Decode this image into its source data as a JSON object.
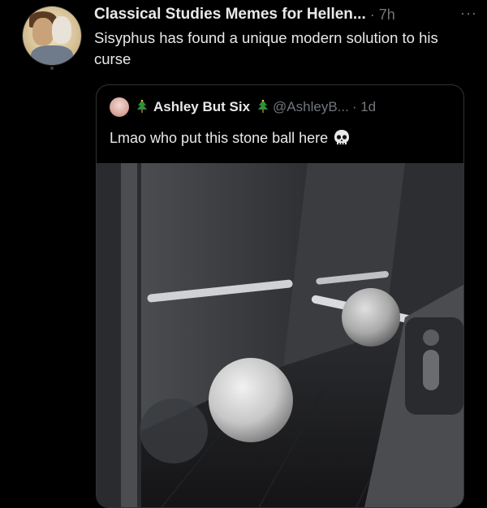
{
  "tweet": {
    "author_name": "Classical Studies Memes for Hellen...",
    "time": "· 7h",
    "more": "···",
    "text": "Sisyphus has found a unique modern solution to his curse"
  },
  "quoted_tweet": {
    "author_name": "Ashley But Six",
    "handle": "@AshleyB...",
    "time": "· 1d",
    "text": "Lmao who put this stone ball here"
  },
  "icons": {
    "avatar": "profile-avatar",
    "tree": "christmas-tree-icon",
    "skull": "skull-icon",
    "more": "more-icon"
  },
  "colors": {
    "background": "#000000",
    "text": "#e7e9ea",
    "secondary": "#71767b",
    "border": "#2f3336"
  }
}
